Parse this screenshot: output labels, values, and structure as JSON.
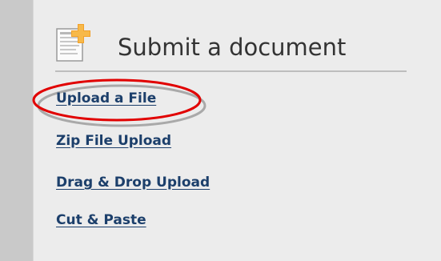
{
  "panel": {
    "title": "Submit a document",
    "icon": "document-add-icon",
    "links": [
      {
        "label": "Upload a File",
        "highlighted": true
      },
      {
        "label": "Zip File Upload"
      },
      {
        "label": "Drag & Drop Upload"
      },
      {
        "label": "Cut & Paste"
      }
    ]
  },
  "colors": {
    "page_background": "#c9c9c9",
    "panel_background": "#ececec",
    "link_color": "#1c3f6b",
    "highlight_circle": "#e10000",
    "accent_plus": "#f2a12a"
  }
}
